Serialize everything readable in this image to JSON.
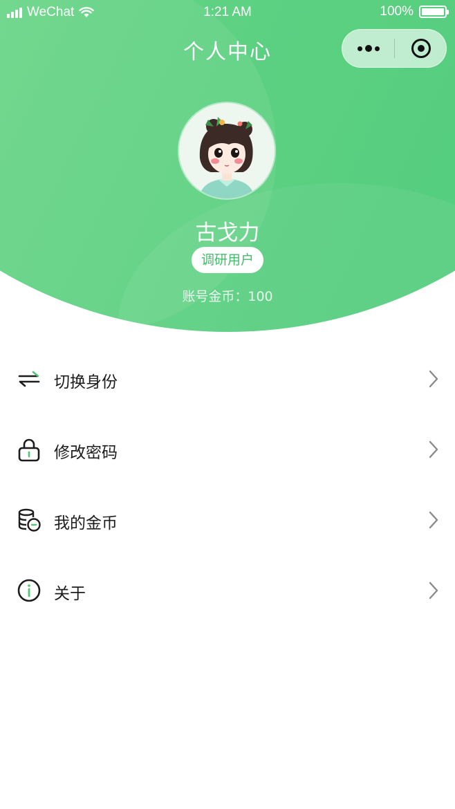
{
  "status_bar": {
    "carrier": "WeChat",
    "time": "1:21 AM",
    "battery": "100%"
  },
  "header": {
    "title": "个人中心"
  },
  "profile": {
    "name": "古戈力",
    "role_badge": "调研用户",
    "coins_text": "账号金币：100"
  },
  "menu": {
    "items": [
      {
        "label": "切换身份",
        "icon": "switch-arrows-icon"
      },
      {
        "label": "修改密码",
        "icon": "lock-icon"
      },
      {
        "label": "我的金币",
        "icon": "coins-icon"
      },
      {
        "label": "关于",
        "icon": "info-icon"
      }
    ]
  },
  "colors": {
    "primary_green": "#5ccf82",
    "badge_text": "#3fbd6a",
    "icon_accent": "#4ec774"
  }
}
